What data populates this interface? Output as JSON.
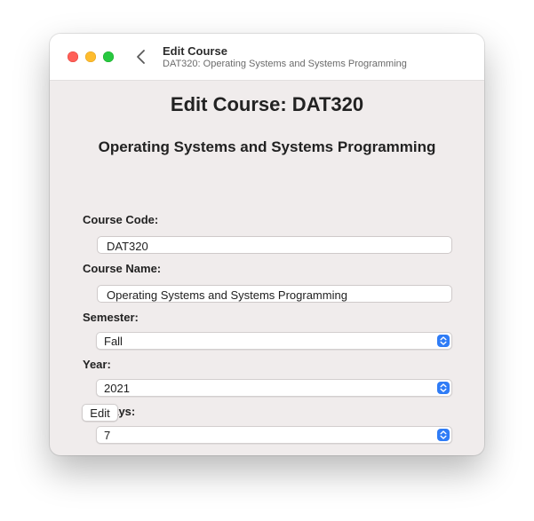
{
  "window": {
    "title": "Edit Course",
    "subtitle": "DAT320: Operating Systems and Systems Programming",
    "controls": {
      "close_color": "#ff5f57",
      "minimize_color": "#febc2e",
      "zoom_color": "#28c840"
    },
    "back_icon": "chevron-left-icon"
  },
  "main": {
    "heading": "Edit Course: DAT320",
    "course_title": "Operating Systems and Systems Programming"
  },
  "form": {
    "course_code": {
      "label": "Course Code:",
      "value": "DAT320"
    },
    "course_name": {
      "label": "Course Name:",
      "value": "Operating Systems and Systems Programming"
    },
    "semester": {
      "label": "Semester:",
      "selected": "Fall"
    },
    "year": {
      "label": "Year:",
      "selected": "2021"
    },
    "slip_days": {
      "label": "SlipDays:",
      "selected": "7"
    },
    "submit_label": "Edit",
    "accent_color": "#2f7cf6"
  }
}
